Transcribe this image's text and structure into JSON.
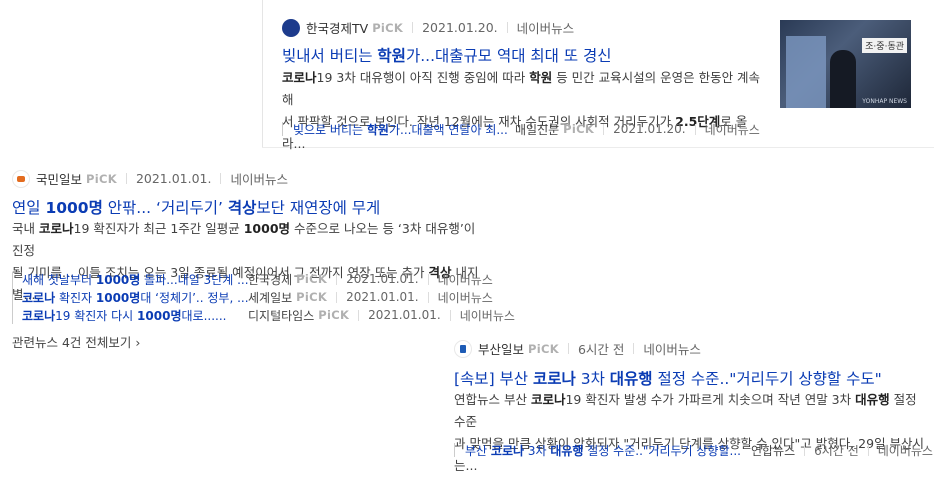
{
  "card1": {
    "press": "한국경제TV",
    "pick": "PiCK",
    "date": "2021.01.20.",
    "source": "네이버뉴스",
    "title_parts": [
      "빚내서 버티는 ",
      "학원",
      "가...대출규모 역대 최대 또 경신"
    ],
    "desc_line1_parts": [
      "코로나",
      "19 3차 대유행이 아직 진행 중임에 따라 ",
      "학원",
      " 등 민간 교육시설의 운영은 한동안 계속해"
    ],
    "desc_line2_parts": [
      "서 팍팍할 것으로 보인다. 작년 12월에는 재차 수도권의 사회적 거리두기가 ",
      "2.5단계",
      "로 올라..."
    ],
    "thumb_caption": "조·중·동관",
    "thumb_watermark": "YONHAP NEWS",
    "related": {
      "title_parts": [
        "빚으로 버티는 ",
        "학원",
        "가...대출액 연달아 최..."
      ],
      "press": "매일신문",
      "pick": "PiCK",
      "date": "2021.01.20.",
      "source": "네이버뉴스"
    }
  },
  "card2": {
    "press": "국민일보",
    "pick": "PiCK",
    "date": "2021.01.01.",
    "source": "네이버뉴스",
    "title_parts": [
      "연일 ",
      "1000명",
      " 안팎... ‘거리두기’ ",
      "격상",
      "보단 재연장에 무게"
    ],
    "desc_line1_parts": [
      "국내 ",
      "코로나",
      "19 확진자가 최근 1주간 일평균 ",
      "1000명",
      " 수준으로 나오는 등 ‘3차 대유행’이 진정"
    ],
    "desc_line2_parts": [
      "될 기미를... 이들 조치는 오는 3일 종료될 예정이어서 그 전까지 연장 또는 추가 ",
      "격상",
      " 내지 별..."
    ],
    "related": [
      {
        "title_parts": [
          "새해 첫날부터 ",
          "1000명",
          " 돌파...내일 3단계 ..."
        ],
        "press": "한국경제",
        "pick": "PiCK",
        "date": "2021.01.01.",
        "source": "네이버뉴스"
      },
      {
        "title_parts": [
          "코로나",
          " 확진자 ",
          "1000명",
          "대 ‘정체기’.. 정부, ..."
        ],
        "press": "세계일보",
        "pick": "PiCK",
        "date": "2021.01.01.",
        "source": "네이버뉴스"
      },
      {
        "title_parts": [
          "코로나",
          "19 확진자 다시 ",
          "1000명",
          "대로......"
        ],
        "press": "디지털타임스",
        "pick": "PiCK",
        "date": "2021.01.01.",
        "source": "네이버뉴스"
      }
    ],
    "more_label": "관련뉴스 4건 전체보기 ›"
  },
  "card3": {
    "press": "부산일보",
    "pick": "PiCK",
    "date": "6시간 전",
    "source": "네이버뉴스",
    "title_parts": [
      "[속보] 부산 ",
      "코로나",
      " 3차 ",
      "대유행",
      " 절정 수준..\"거리두기 상향할 수도\""
    ],
    "desc_line1_parts": [
      "연합뉴스 부산 ",
      "코로나",
      "19 확진자 발생 수가 가파르게 치솟으며 작년 연말 3차 ",
      "대유행",
      " 절정 수준"
    ],
    "desc_line2_parts": [
      "과 맞먹을 만큼 상황이 악화되자 \"거리두기 단계를 상향할 수 있다\"고 밝혔다. 29일 부산시는..."
    ],
    "related": {
      "title_parts": [
        "부산 ",
        "코로나",
        " 3차 ",
        "대유행",
        " 절정 수준..\"거리두기 상향할..."
      ],
      "press": "연합뉴스",
      "date": "6시간 전",
      "source": "네이버뉴스"
    }
  },
  "colors": {
    "link": "#0b3cb4",
    "pick": "#b0b0b0",
    "meta": "#666666"
  }
}
